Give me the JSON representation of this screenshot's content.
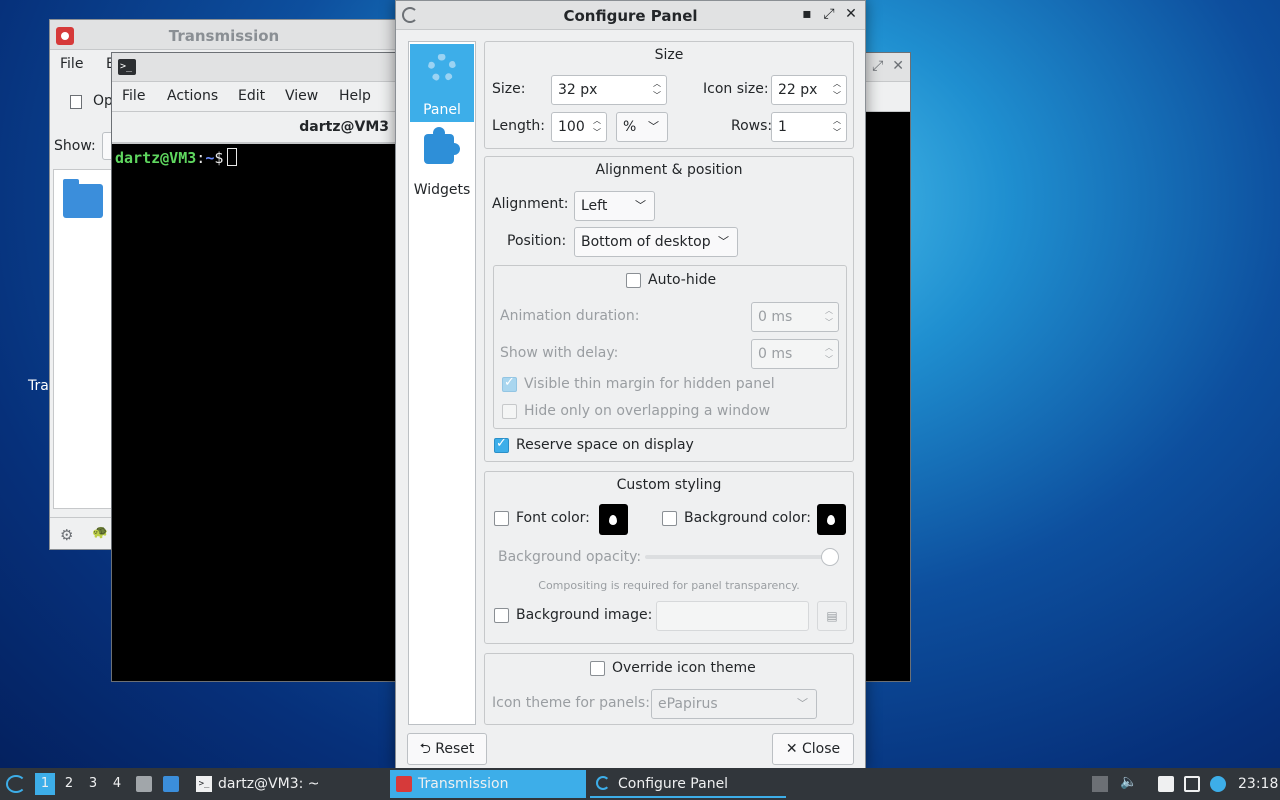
{
  "desktop": {
    "partial_label": "Tra"
  },
  "transmission": {
    "title": "Transmission",
    "menu": [
      "File",
      "E"
    ],
    "toolbar_partial": "Op",
    "show_label": "Show:"
  },
  "terminal": {
    "menu": [
      "File",
      "Actions",
      "Edit",
      "View",
      "Help"
    ],
    "tab_title": "dartz@VM3",
    "prompt_user": "dartz@VM3",
    "prompt_sep": ":",
    "prompt_path": "~",
    "prompt_symbol": "$"
  },
  "dialog": {
    "title": "Configure Panel",
    "sidebar": [
      {
        "label": "Panel",
        "icon": "gear-icon",
        "active": true
      },
      {
        "label": "Widgets",
        "icon": "puzzle-icon",
        "active": false
      }
    ],
    "size": {
      "title": "Size",
      "size_label": "Size:",
      "size_value": "32 px",
      "icon_size_label": "Icon size:",
      "icon_size_value": "22 px",
      "length_label": "Length:",
      "length_value": "100",
      "length_unit": "%",
      "rows_label": "Rows:",
      "rows_value": "1"
    },
    "alignment": {
      "title": "Alignment & position",
      "alignment_label": "Alignment:",
      "alignment_value": "Left",
      "position_label": "Position:",
      "position_value": "Bottom of desktop",
      "autohide_label": "Auto-hide",
      "autohide_checked": false,
      "anim_label": "Animation duration:",
      "anim_value": "0 ms",
      "delay_label": "Show with delay:",
      "delay_value": "0 ms",
      "thin_margin_label": "Visible thin margin for hidden panel",
      "thin_margin_checked": true,
      "overlap_label": "Hide only on overlapping a window",
      "overlap_checked": false,
      "reserve_label": "Reserve space on display",
      "reserve_checked": true
    },
    "styling": {
      "title": "Custom styling",
      "font_color_label": "Font color:",
      "bg_color_label": "Background color:",
      "opacity_label": "Background opacity:",
      "opacity_value": 1.0,
      "compositing_note": "Compositing is required for panel transparency.",
      "bg_image_label": "Background image:",
      "bg_image_value": ""
    },
    "icon_theme": {
      "override_label": "Override icon theme",
      "override_checked": false,
      "theme_label": "Icon theme for panels:",
      "theme_value": "ePapirus"
    },
    "buttons": {
      "reset": "Reset",
      "close": "Close"
    }
  },
  "taskbar": {
    "desktops": [
      "1",
      "2",
      "3",
      "4"
    ],
    "active_desktop": "1",
    "tasks": [
      {
        "label": "dartz@VM3: ~",
        "active": false
      },
      {
        "label": "Transmission",
        "active": true
      },
      {
        "label": "Configure Panel",
        "active": false
      }
    ],
    "clock": "23:18"
  },
  "colors": {
    "accent": "#3daee9",
    "taskbar_bg": "#31363b",
    "terminal_user": "#5fd75f",
    "terminal_path": "#6c8cff"
  }
}
